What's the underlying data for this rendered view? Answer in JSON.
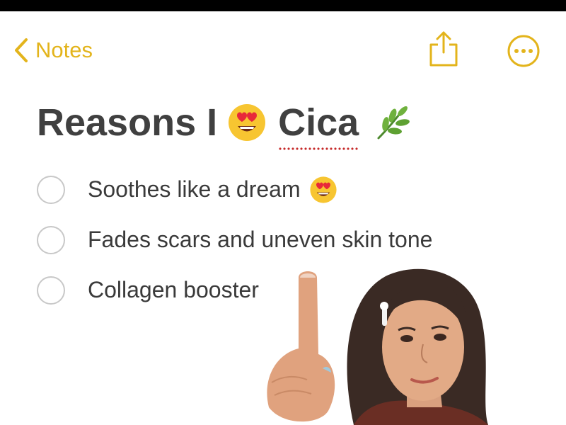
{
  "nav": {
    "back_label": "Notes",
    "accent_color": "#e3b41c",
    "back_icon": "chevron-left-icon",
    "share_icon": "share-icon",
    "more_icon": "ellipsis-circle-icon"
  },
  "note": {
    "title_word_1": "Reasons I",
    "title_emoji_1": "heart-eyes-emoji",
    "title_word_2": "Cica",
    "title_emoji_2": "herb-emoji",
    "items": [
      {
        "text": "Soothes like a dream",
        "emoji": "heart-eyes-emoji",
        "checked": false
      },
      {
        "text": "Fades scars and uneven skin tone",
        "checked": false
      },
      {
        "text": "Collagen booster",
        "checked": false
      }
    ]
  },
  "overlay": {
    "image": "person-pointing-up-photo"
  }
}
